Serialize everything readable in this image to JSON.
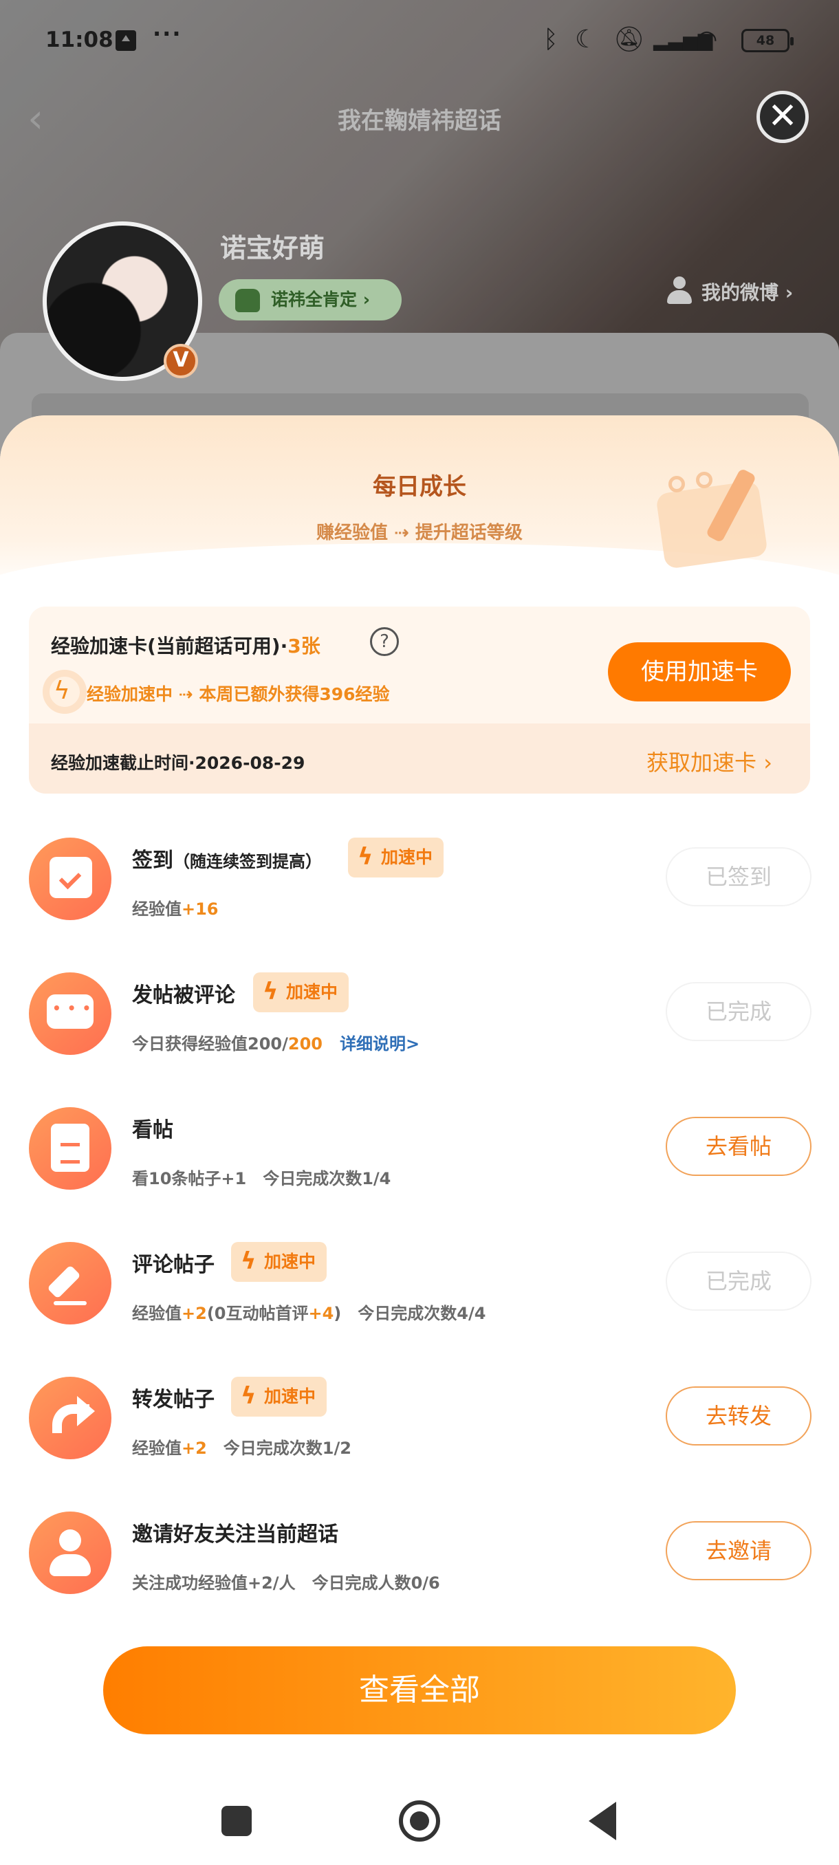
{
  "status_bar": {
    "time": "11:08",
    "more": "···",
    "battery": "48",
    "icons": [
      "upload-icon",
      "bluetooth-icon",
      "moon-icon",
      "mute-icon",
      "signal-icon",
      "wifi-icon",
      "battery-icon"
    ]
  },
  "header": {
    "title": "我在鞠婧祎超话",
    "user_name": "诺宝好萌",
    "fan_badge": "诺祎全肯定",
    "my_weibo": "我的微博",
    "verified_badge": "V"
  },
  "sheet": {
    "title": "每日成长",
    "subtitle": "赚经验值 ⇢ 提升超话等级"
  },
  "boost_card": {
    "title_prefix": "经验加速卡(当前超话可用)·",
    "count": "3张",
    "help": "?",
    "status": "经验加速中 ⇢ 本周已额外获得396经验",
    "use_button": "使用加速卡",
    "deadline": "经验加速截止时间·2026-08-29",
    "get_card": "获取加速卡"
  },
  "speed_tag_label": "加速中",
  "tasks": [
    {
      "name": "签到",
      "note": "（随连续签到提高）",
      "desc_a": "经验值",
      "desc_hl": "+16",
      "button": "已签到",
      "state": "done"
    },
    {
      "name": "发帖被评论",
      "desc_a": "今日获得经验值200/",
      "desc_hl": "200",
      "link": "详细说明>",
      "button": "已完成",
      "state": "done"
    },
    {
      "name": "看帖",
      "desc_a": "看10条帖子+1　今日完成次数1/4",
      "button": "去看帖",
      "state": "go"
    },
    {
      "name": "评论帖子",
      "desc_a": "经验值",
      "desc_hl": "+2",
      "desc_b": "(0互动帖首评",
      "desc_hl2": "+4",
      "desc_c": ")　今日完成次数4/4",
      "button": "已完成",
      "state": "done"
    },
    {
      "name": "转发帖子",
      "desc_a": "经验值",
      "desc_hl": "+2",
      "desc_b": "　今日完成次数1/2",
      "button": "去转发",
      "state": "go"
    },
    {
      "name": "邀请好友关注当前超话",
      "desc_a": "关注成功经验值+2/人　今日完成人数0/6",
      "button": "去邀请",
      "state": "go"
    }
  ],
  "view_all": "查看全部",
  "colors": {
    "accent": "#ff7a00",
    "highlight": "#f08a1b",
    "link": "#2f6fb7",
    "sheet_title": "#b5561e"
  }
}
